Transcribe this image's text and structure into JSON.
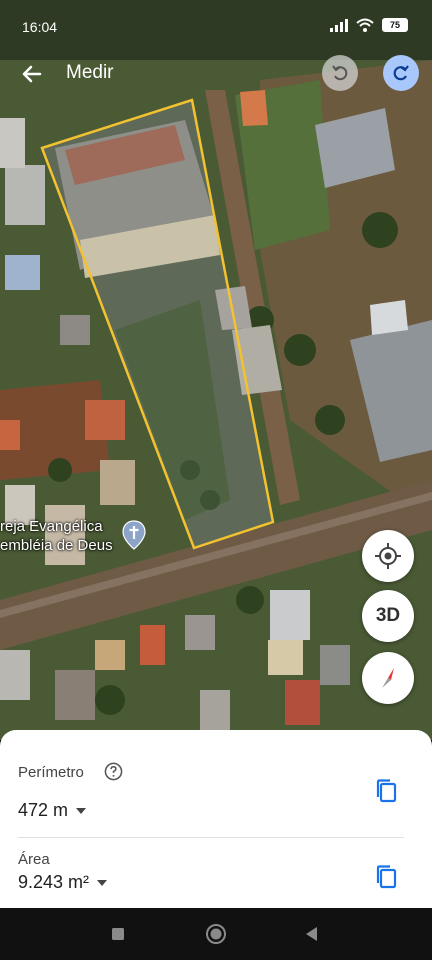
{
  "status": {
    "time": "16:04",
    "battery": "75"
  },
  "toolbar": {
    "title": "Medir"
  },
  "map": {
    "place_line1": "reja Evangélica",
    "place_line2": "embléia de Deus"
  },
  "fab": {
    "three_d_label": "3D"
  },
  "measurements": {
    "perimeter_label": "Perímetro",
    "perimeter_value": "472 m",
    "area_label": "Área",
    "area_value": "9.243 m²"
  },
  "colors": {
    "polygon": "#f2c230",
    "accent": "#1a73e8",
    "redo_bg": "#a8c7fa"
  },
  "icons": [
    "back-arrow-icon",
    "undo-icon",
    "redo-icon",
    "help-icon",
    "copy-icon",
    "my-location-icon",
    "compass-icon",
    "nav-square-icon",
    "nav-home-icon",
    "nav-back-icon",
    "place-pin-icon"
  ]
}
